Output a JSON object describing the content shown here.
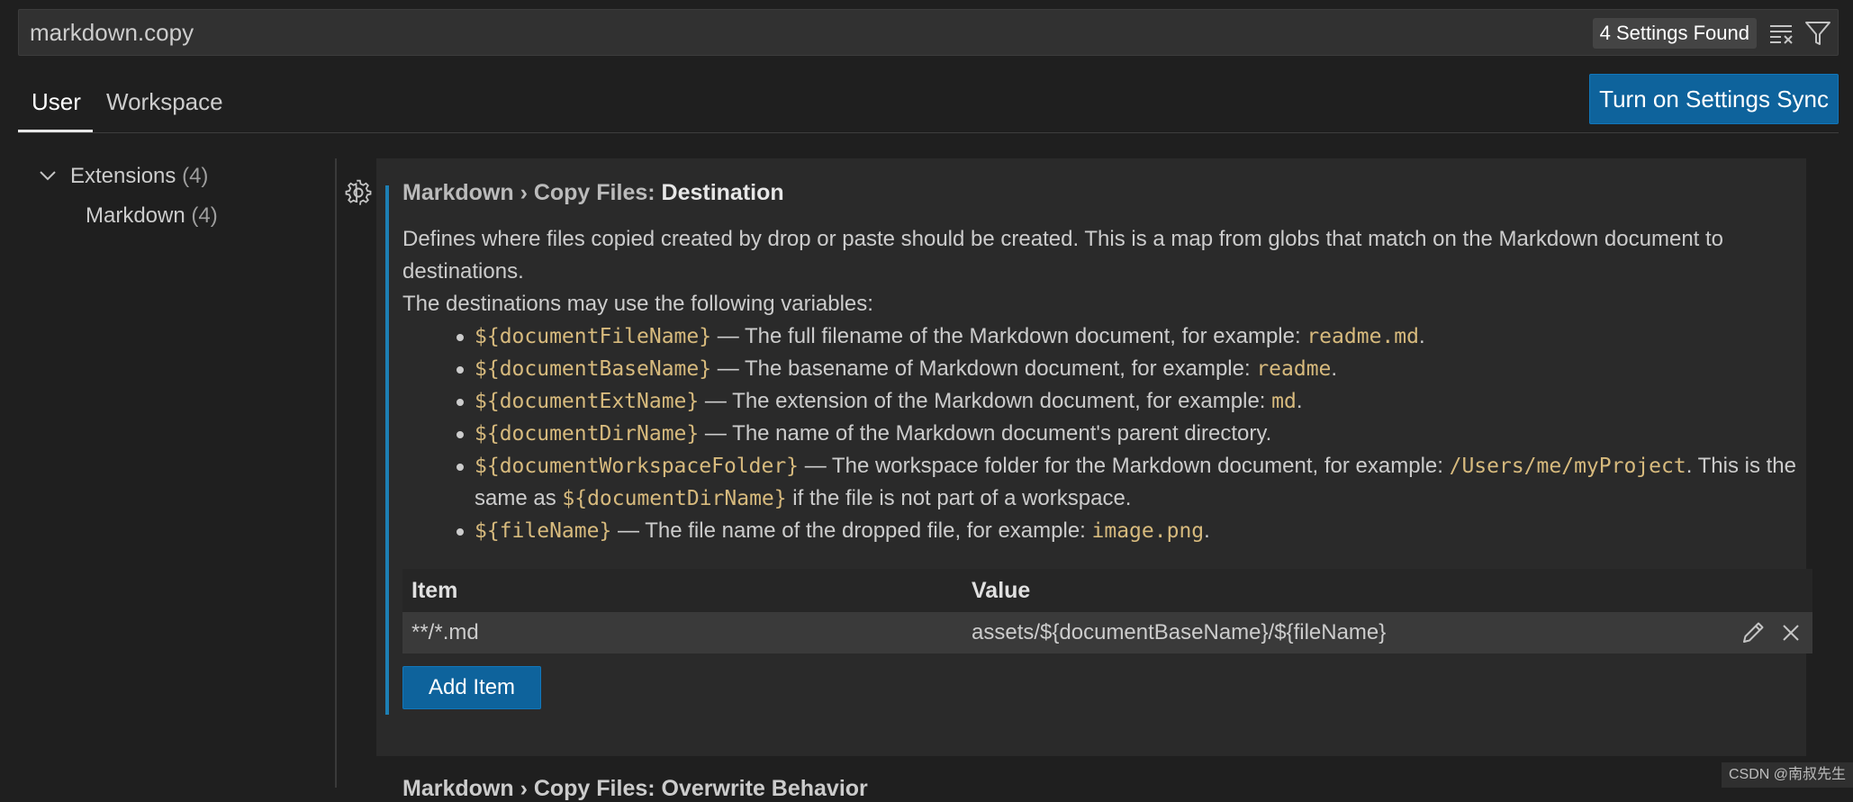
{
  "search": {
    "value": "markdown.copy",
    "results_badge": "4 Settings Found"
  },
  "tabs": [
    {
      "label": "User",
      "active": true
    },
    {
      "label": "Workspace",
      "active": false
    }
  ],
  "sync_button": "Turn on Settings Sync",
  "tree": {
    "extensions": {
      "label": "Extensions",
      "count": "(4)"
    },
    "markdown": {
      "label": "Markdown",
      "count": "(4)"
    }
  },
  "setting": {
    "title_crumb": "Markdown › Copy Files: ",
    "title_leaf": "Destination",
    "desc_line1": "Defines where files copied created by drop or paste should be created. This is a map from globs that match on the Markdown document to destinations.",
    "desc_line2": "The destinations may use the following variables:",
    "vars": [
      {
        "code": "${documentFileName}",
        "text": " — The full filename of the Markdown document, for example: ",
        "example": "readme.md",
        "tail": "."
      },
      {
        "code": "${documentBaseName}",
        "text": " — The basename of Markdown document, for example: ",
        "example": "readme",
        "tail": "."
      },
      {
        "code": "${documentExtName}",
        "text": " — The extension of the Markdown document, for example: ",
        "example": "md",
        "tail": "."
      },
      {
        "code": "${documentDirName}",
        "text": " — The name of the Markdown document's parent directory.",
        "example": "",
        "tail": ""
      },
      {
        "code": "${documentWorkspaceFolder}",
        "text": " — The workspace folder for the Markdown document, for example: ",
        "example": "/Users/me/myProject",
        "tail": ". This is the same as ",
        "code2": "${documentDirName}",
        "tail2": " if the file is not part of a workspace."
      },
      {
        "code": "${fileName}",
        "text": " — The file name of the dropped file, for example: ",
        "example": "image.png",
        "tail": "."
      }
    ],
    "table": {
      "headers": {
        "item": "Item",
        "value": "Value"
      },
      "rows": [
        {
          "item": "**/*.md",
          "value": "assets/${documentBaseName}/${fileName}"
        }
      ]
    },
    "add_item": "Add Item"
  },
  "next_setting_title": "Markdown › Copy Files: Overwrite Behavior",
  "watermark": "CSDN @南叔先生",
  "colors": {
    "accent": "#1d7fb4",
    "button": "#0e639c",
    "code": "#d7ba7d",
    "background": "#1f1f1f"
  },
  "icons": {
    "clear": "clear-filter-icon",
    "filter": "filter-icon",
    "gear": "gear-icon",
    "edit": "pencil-icon",
    "remove": "close-icon",
    "chevron": "chevron-down-icon"
  }
}
